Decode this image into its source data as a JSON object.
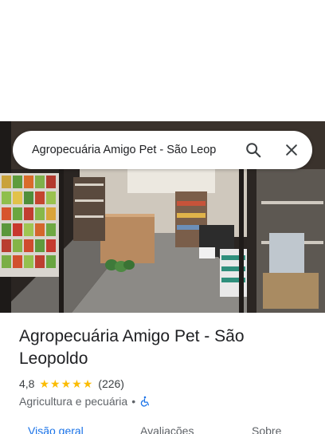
{
  "search": {
    "query": "Agropecuária Amigo Pet - São Leop",
    "search_icon": "search-icon",
    "close_icon": "close-icon"
  },
  "place": {
    "name": "Agropecuária Amigo Pet - São Leopoldo",
    "rating": "4,8",
    "stars": 5,
    "review_count": "(226)",
    "category": "Agricultura e pecuária",
    "separator": "•",
    "accessibility_icon": "wheelchair-icon"
  },
  "tabs": [
    {
      "label": "Visão geral",
      "active": true
    },
    {
      "label": "Avaliações",
      "active": false
    },
    {
      "label": "Sobre",
      "active": false
    }
  ],
  "colors": {
    "accent": "#1a73e8",
    "star": "#fbbc04",
    "text_primary": "#202124",
    "text_secondary": "#5f6368"
  }
}
